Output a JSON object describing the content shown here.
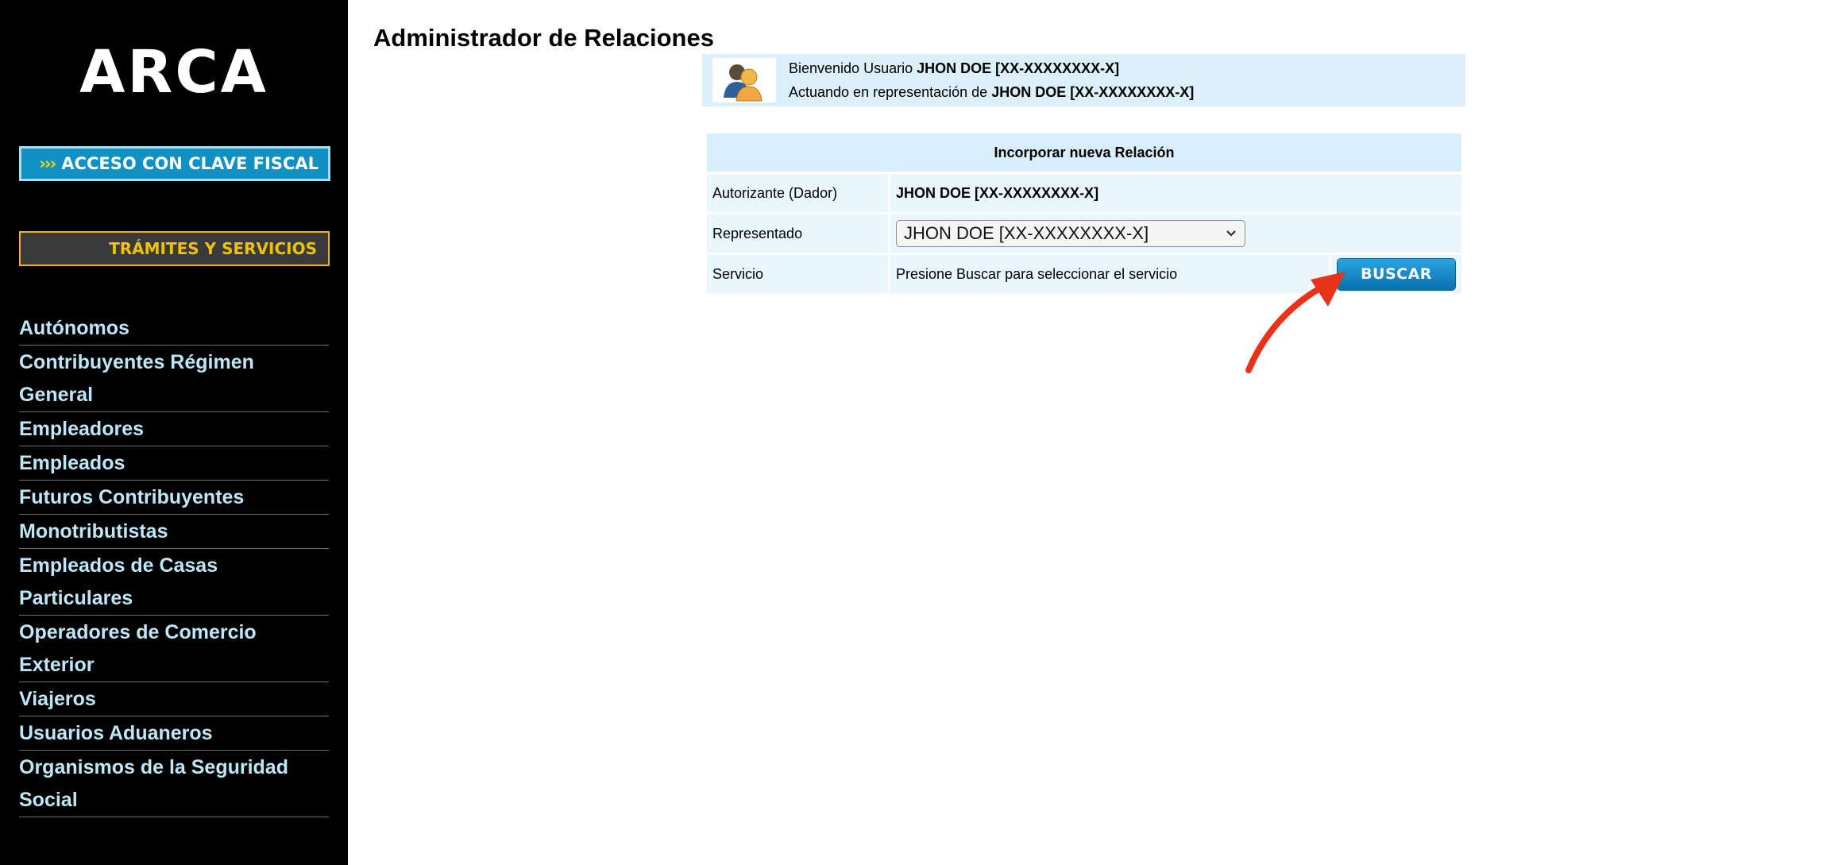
{
  "sidebar": {
    "logo": "ARCA",
    "clave_fiscal": {
      "arrows": "›››",
      "label": "ACCESO CON CLAVE FISCAL"
    },
    "tramites": "TRÁMITES Y SERVICIOS",
    "items": [
      {
        "label": "Autónomos"
      },
      {
        "label": "Contribuyentes Régimen General"
      },
      {
        "label": "Empleadores"
      },
      {
        "label": "Empleados"
      },
      {
        "label": "Futuros Contribuyentes"
      },
      {
        "label": "Monotributistas"
      },
      {
        "label": "Empleados de Casas Particulares"
      },
      {
        "label": "Operadores de Comercio Exterior"
      },
      {
        "label": "Viajeros"
      },
      {
        "label": "Usuarios Aduaneros"
      },
      {
        "label": "Organismos de la Seguridad Social"
      }
    ]
  },
  "page": {
    "title": "Administrador de Relaciones"
  },
  "welcome": {
    "line1_prefix": "Bienvenido Usuario",
    "line1_name": "JHON DOE [XX-XXXXXXXX-X]",
    "line2_prefix": "Actuando en representación de",
    "line2_name": "JHON DOE [XX-XXXXXXXX-X]"
  },
  "form": {
    "header": "Incorporar nueva Relación",
    "autorizante_label": "Autorizante (Dador)",
    "autorizante_value": "JHON DOE [XX-XXXXXXXX-X]",
    "representado_label": "Representado",
    "representado_selected": "JHON DOE [XX-XXXXXXXX-X]",
    "servicio_label": "Servicio",
    "servicio_text": "Presione Buscar para seleccionar el servicio",
    "buscar_label": "BUSCAR"
  },
  "colors": {
    "sidebar_bg": "#000000",
    "nav_text": "#bfe6f7",
    "clave_bg": "#1190c4",
    "tramites_text": "#f2c200",
    "table_bg": "#e9f6fd",
    "arrow": "#e8321a"
  },
  "icons": {
    "avatar": "users-icon",
    "arrow": "red-arrow-annotation"
  }
}
